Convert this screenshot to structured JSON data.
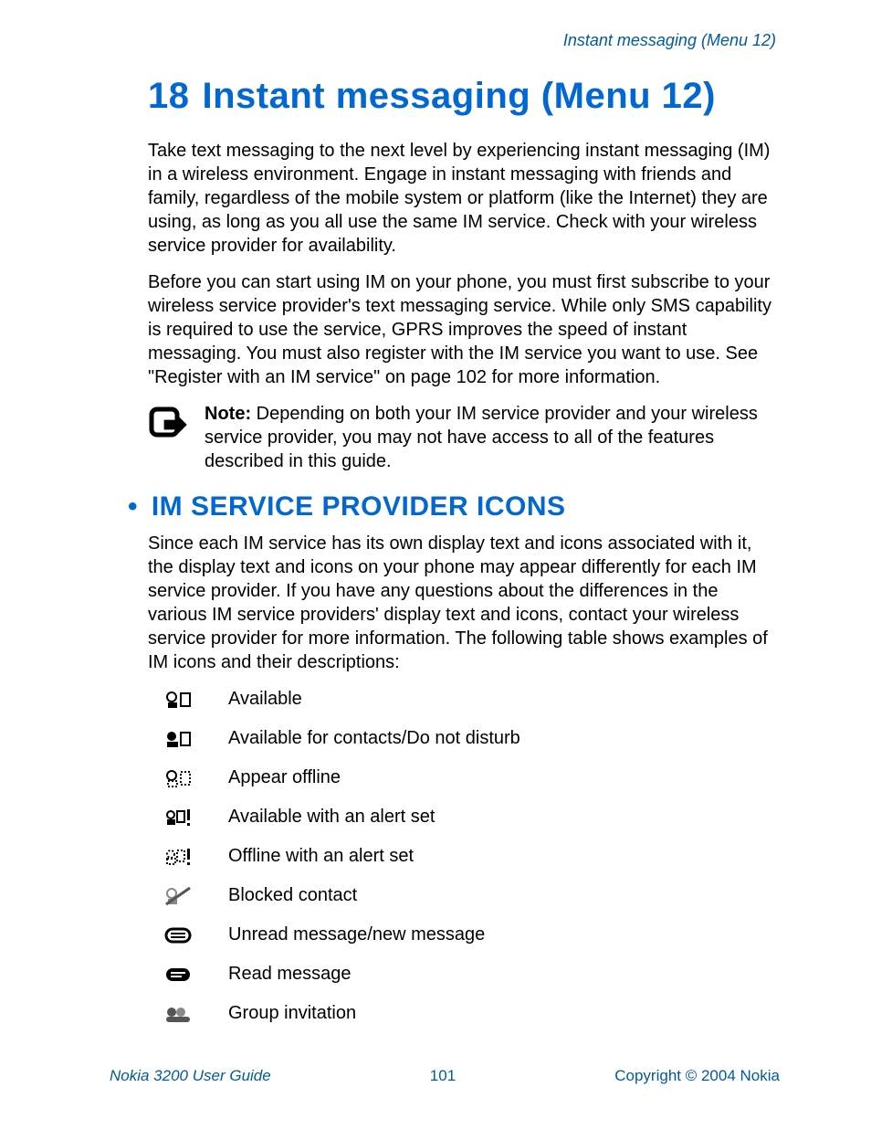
{
  "running_header": "Instant messaging (Menu 12)",
  "chapter": {
    "number": "18",
    "title": "Instant messaging (Menu 12)"
  },
  "paragraphs": {
    "p1": "Take text messaging to the next level by experiencing instant messaging (IM) in a wireless environment. Engage in instant messaging with friends and family, regardless of the mobile system or platform (like the Internet) they are using, as long as you all use the same IM service. Check with your wireless service provider for availability.",
    "p2": "Before you can start using IM on your phone, you must first subscribe to your wireless service provider's text messaging service. While only SMS capability is required to use the service, GPRS improves the speed of instant messaging. You must also register with the IM service you want to use. See \"Register with an IM service\" on page 102 for more information."
  },
  "note": {
    "label": "Note:",
    "text": " Depending on both your IM service provider and your wireless service provider, you may not have access to all of the features described in this guide."
  },
  "section": {
    "bullet": "•",
    "heading": " IM SERVICE PROVIDER ICONS",
    "intro": "Since each IM service has its own display text and icons associated with it, the display text and icons on your phone may appear differently for each IM service provider. If you have any questions about the differences in the various IM service providers' display text and icons, contact your wireless service provider for more information. The following table shows examples of IM icons and their descriptions:"
  },
  "icon_rows": [
    {
      "icon": "im-available-icon",
      "desc": "Available"
    },
    {
      "icon": "im-dnd-icon",
      "desc": "Available for contacts/Do not disturb"
    },
    {
      "icon": "im-appear-offline-icon",
      "desc": "Appear offline"
    },
    {
      "icon": "im-available-alert-icon",
      "desc": "Available with an alert set"
    },
    {
      "icon": "im-offline-alert-icon",
      "desc": "Offline with an alert set"
    },
    {
      "icon": "im-blocked-icon",
      "desc": "Blocked contact"
    },
    {
      "icon": "im-unread-msg-icon",
      "desc": "Unread message/new message"
    },
    {
      "icon": "im-read-msg-icon",
      "desc": "Read message"
    },
    {
      "icon": "im-group-invite-icon",
      "desc": "Group invitation"
    }
  ],
  "footer": {
    "guide": "Nokia 3200 User Guide",
    "page": "101",
    "copyright": "Copyright © 2004 Nokia"
  }
}
